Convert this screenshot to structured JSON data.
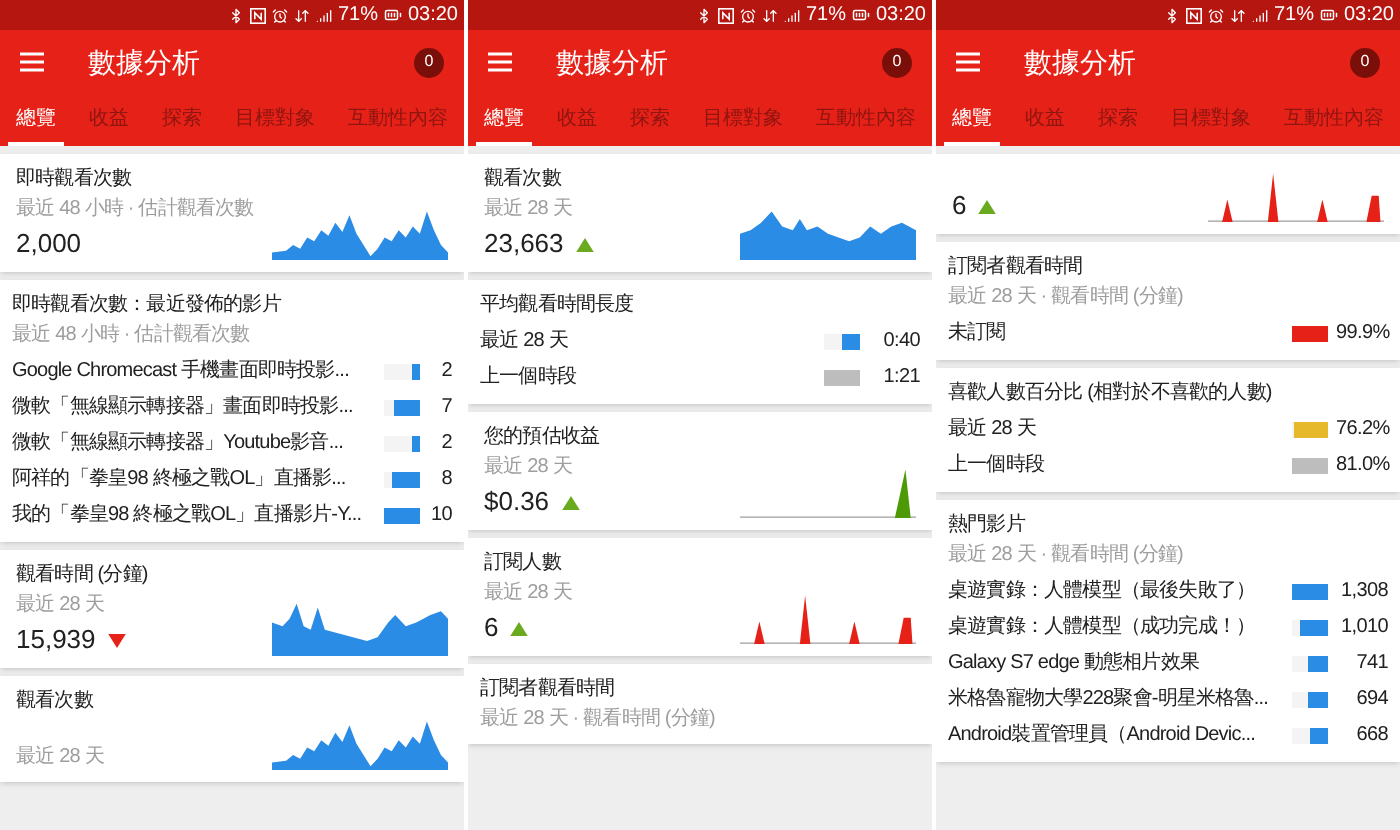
{
  "screens": [
    {
      "status_bar": {
        "battery": "71%",
        "time": "03:20"
      },
      "app_bar": {
        "title": "數據分析",
        "badge": "0"
      },
      "tabs": [
        {
          "label": "總覽",
          "selected": true
        },
        {
          "label": "收益",
          "selected": false
        },
        {
          "label": "探索",
          "selected": false
        },
        {
          "label": "目標對象",
          "selected": false
        },
        {
          "label": "互動性內容",
          "selected": false
        }
      ],
      "cards": [
        {
          "kind": "metric",
          "title": "即時觀看次數",
          "subtitle": "最近 48 小時 · 估計觀看次數",
          "value": "2,000",
          "graph": {
            "kind": "area"
          }
        },
        {
          "kind": "bars",
          "title": "即時觀看次數：最近發佈的影片",
          "subtitle": "最近 48 小時 · 估計觀看次數",
          "rows": [
            {
              "label": "Google Chromecast 手機畫面即時投影...",
              "level": 0.2,
              "value": "2",
              "color": "#2b8ce6"
            },
            {
              "label": "微軟「無線顯示轉接器」畫面即時投影...",
              "level": 0.7,
              "value": "7",
              "color": "#2b8ce6"
            },
            {
              "label": "微軟「無線顯示轉接器」Youtube影音...",
              "level": 0.2,
              "value": "2",
              "color": "#2b8ce6"
            },
            {
              "label": "阿祥的「拳皇98 終極之戰OL」直播影...",
              "level": 0.8,
              "value": "8",
              "color": "#2b8ce6"
            },
            {
              "label": "我的「拳皇98 終極之戰OL」直播影片-Y...",
              "level": 1.0,
              "value": "10",
              "color": "#2b8ce6"
            }
          ]
        },
        {
          "kind": "metric",
          "title": "觀看時間 (分鐘)",
          "subtitle": "最近 28 天",
          "value": "15,939",
          "rising": false,
          "graph": {
            "kind": "area"
          }
        },
        {
          "kind": "metric",
          "title": "觀看次數",
          "subtitle": "最近 28 天",
          "graph": {
            "kind": "area"
          }
        }
      ]
    },
    {
      "status_bar": {
        "battery": "71%",
        "time": "03:20"
      },
      "app_bar": {
        "title": "數據分析",
        "badge": "0"
      },
      "tabs": [
        {
          "label": "總覽",
          "selected": true
        },
        {
          "label": "收益",
          "selected": false
        },
        {
          "label": "探索",
          "selected": false
        },
        {
          "label": "目標對象",
          "selected": false
        },
        {
          "label": "互動性內容",
          "selected": false
        }
      ],
      "cards": [
        {
          "kind": "metric",
          "title": "觀看次數",
          "subtitle": "最近 28 天",
          "value": "23,663",
          "rising": true,
          "graph": {
            "kind": "area"
          }
        },
        {
          "kind": "bars",
          "title": "平均觀看時間長度",
          "rows": [
            {
              "label": "最近 28 天",
              "level": 0.5,
              "value": "0:40",
              "color": "#2b8ce6"
            },
            {
              "label": "上一個時段",
              "level": 1.0,
              "value": "1:21",
              "color": "#bdbdbd"
            }
          ]
        },
        {
          "kind": "metric",
          "title": "您的預估收益",
          "subtitle": "最近 28 天",
          "value": "$0.36",
          "rising": true,
          "graph": {
            "kind": "spike"
          }
        },
        {
          "kind": "metric",
          "title": "訂閱人數",
          "subtitle": "最近 28 天",
          "value": "6",
          "rising": true,
          "graph": {
            "kind": "peaks"
          }
        },
        {
          "kind": "bars",
          "title": "訂閱者觀看時間",
          "subtitle": "最近 28 天 · 觀看時間 (分鐘)"
        }
      ]
    },
    {
      "status_bar": {
        "battery": "71%",
        "time": "03:20"
      },
      "app_bar": {
        "title": "數據分析",
        "badge": "0"
      },
      "tabs": [
        {
          "label": "總覽",
          "selected": true
        },
        {
          "label": "收益",
          "selected": false
        },
        {
          "label": "探索",
          "selected": false
        },
        {
          "label": "目標對象",
          "selected": false
        },
        {
          "label": "互動性內容",
          "selected": false
        }
      ],
      "cards": [
        {
          "kind": "metric",
          "value": "6",
          "rising": true,
          "graph": {
            "kind": "peaks"
          }
        },
        {
          "kind": "bars",
          "title": "訂閱者觀看時間",
          "subtitle": "最近 28 天 · 觀看時間 (分鐘)",
          "rows": [
            {
              "label": "未訂閱",
              "level": 1.0,
              "value": "99.9%",
              "color": "#e62117"
            }
          ]
        },
        {
          "kind": "bars",
          "title": "喜歡人數百分比 (相對於不喜歡的人數)",
          "rows": [
            {
              "label": "最近 28 天",
              "level": 0.94,
              "value": "76.2%",
              "color": "#e6b92b"
            },
            {
              "label": "上一個時段",
              "level": 1.0,
              "value": "81.0%",
              "color": "#bdbdbd"
            }
          ]
        },
        {
          "kind": "bars",
          "title": "熱門影片",
          "subtitle": "最近 28 天 · 觀看時間 (分鐘)",
          "rows": [
            {
              "label": "桌遊實錄：人體模型（最後失敗了）",
              "level": 1.0,
              "value": "1,308",
              "color": "#2b8ce6"
            },
            {
              "label": "桌遊實錄：人體模型（成功完成！）",
              "level": 0.77,
              "value": "1,010",
              "color": "#2b8ce6"
            },
            {
              "label": "Galaxy S7 edge 動態相片效果",
              "level": 0.57,
              "value": "741",
              "color": "#2b8ce6"
            },
            {
              "label": "米格魯寵物大學228聚會-明星米格魯...",
              "level": 0.53,
              "value": "694",
              "color": "#2b8ce6"
            },
            {
              "label": "Android裝置管理員（Android Devic...",
              "level": 0.51,
              "value": "668",
              "color": "#2b8ce6"
            }
          ]
        }
      ]
    }
  ]
}
